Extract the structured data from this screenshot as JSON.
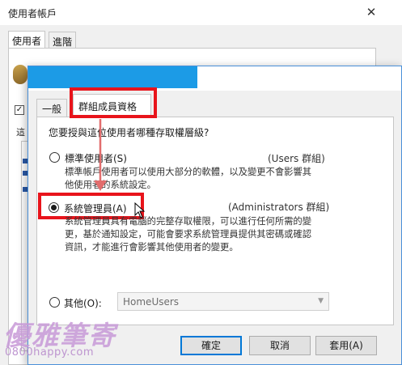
{
  "background_window": {
    "title": "使用者帳戶",
    "close_glyph": "✕",
    "tabs": [
      "使用者",
      "進階"
    ],
    "partial_label": "這"
  },
  "dialog": {
    "tabs": {
      "general": "一般",
      "group": "群組成員資格"
    },
    "question": "您要授與這位使用者哪種存取權層級?",
    "options": [
      {
        "label": "標準使用者(S)",
        "group": "(Users 群組)",
        "selected": false,
        "desc": [
          "標準帳戶使用者可以使用大部分的軟體，以及變更不會影響其",
          "他使用者的系統設定。"
        ]
      },
      {
        "label": "系統管理員(A)",
        "group": "(Administrators 群組)",
        "selected": true,
        "desc": [
          "系統管理員具有電腦的完整存取權限，可以進行任何所需的變",
          "更，基於通知設定，可能會要求系統管理員提供其密碼或確認",
          "資訊，才能進行會影響其他使用者的變更。"
        ]
      },
      {
        "label": "其他(O):",
        "selected": false,
        "select_value": "HomeUsers"
      }
    ],
    "buttons": {
      "ok": "確定",
      "cancel": "取消",
      "apply": "套用(A)"
    }
  },
  "watermark": {
    "text": "優雅筆寄",
    "url": "0800happy.com"
  },
  "colors": {
    "highlight": "#e8141b",
    "title_accent": "#1c9be6",
    "arrow": "#e26d6d"
  }
}
